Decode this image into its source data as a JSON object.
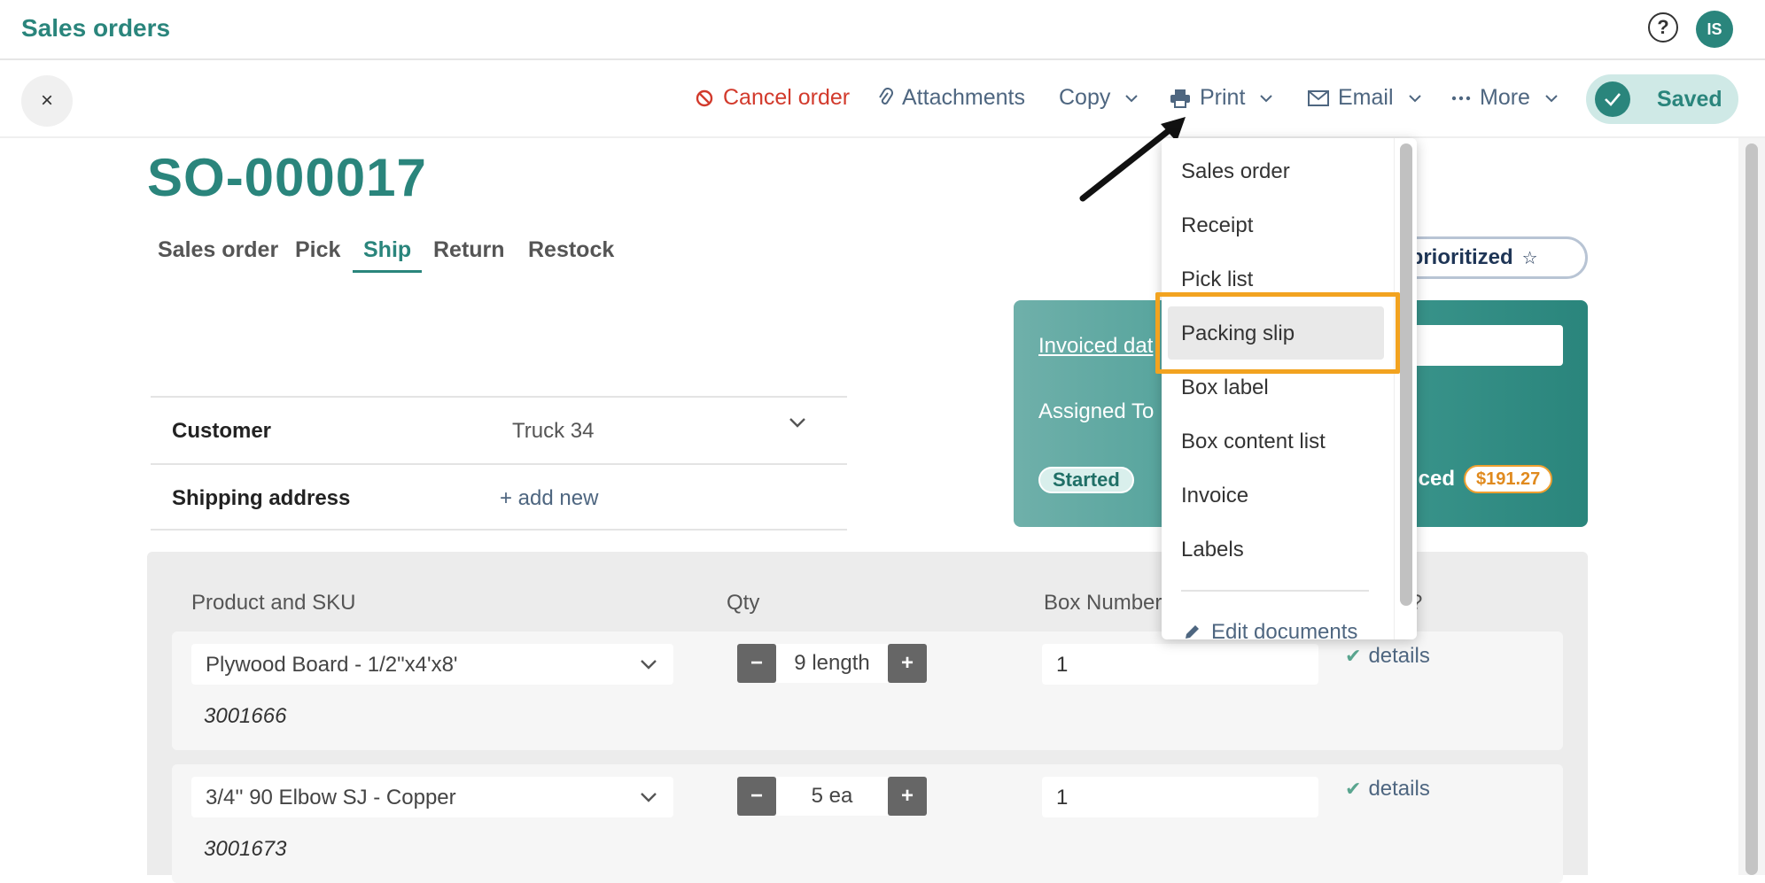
{
  "header": {
    "title": "Sales orders",
    "help_icon": "?",
    "avatar_initials": "IS"
  },
  "toolbar": {
    "close_icon": "×",
    "cancel_order": "Cancel order",
    "attachments": "Attachments",
    "copy": "Copy",
    "print": "Print",
    "email": "Email",
    "more": "More",
    "saved": "Saved"
  },
  "order": {
    "number": "SO-000017",
    "tabs": [
      "Sales order",
      "Pick",
      "Ship",
      "Return",
      "Restock"
    ],
    "active_tab": "Ship"
  },
  "fields": {
    "customer_label": "Customer",
    "customer_value": "Truck 34",
    "shipping_label": "Shipping address",
    "shipping_value": "+ add new"
  },
  "status_card": {
    "priority": "t prioritized",
    "invoiced_date": "Invoiced dat",
    "assigned_to": "Assigned To",
    "status": "Started",
    "invoiced": "iced",
    "amount": "$191.27"
  },
  "items": {
    "columns": [
      "Product and SKU",
      "Qty",
      "Box Number",
      "?"
    ],
    "rows": [
      {
        "product": "Plywood Board - 1/2\"x4'x8'",
        "sku": "3001666",
        "qty": "9 length",
        "box": "1",
        "details": "details"
      },
      {
        "product": "3/4'' 90 Elbow SJ - Copper",
        "sku": "3001673",
        "qty": "5 ea",
        "box": "1",
        "details": "details"
      }
    ]
  },
  "print_menu": {
    "items": [
      "Sales order",
      "Receipt",
      "Pick list",
      "Packing slip",
      "Box label",
      "Box content list",
      "Invoice",
      "Labels"
    ],
    "highlighted": "Packing slip",
    "edit_documents": "Edit documents"
  },
  "colors": {
    "brand_teal": "#2a857c",
    "cancel_red": "#d23a2c",
    "link_slate": "#4e6680",
    "highlight_orange": "#f2a320"
  }
}
